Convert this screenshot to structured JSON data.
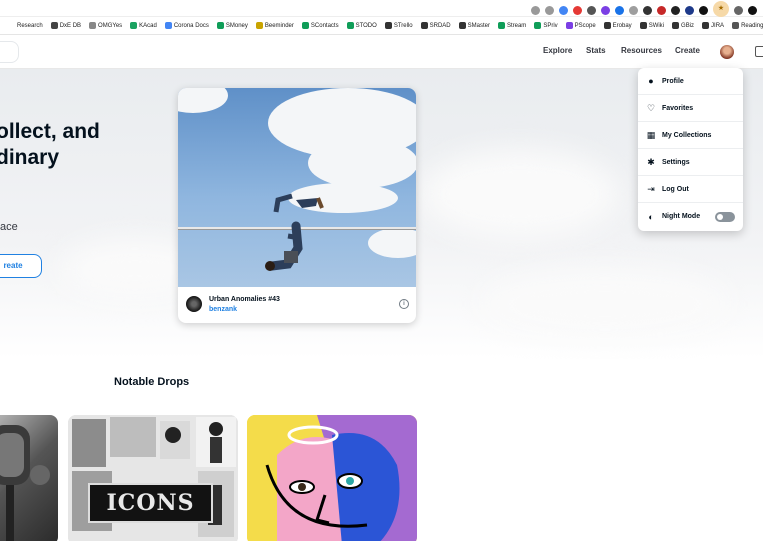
{
  "bookmarks": [
    {
      "label": "Research",
      "color": "#ffffff"
    },
    {
      "label": "DxE DB",
      "color": "#444444"
    },
    {
      "label": "OMGYes",
      "color": "#888888"
    },
    {
      "label": "KAcad",
      "color": "#1aa260"
    },
    {
      "label": "Corona Docs",
      "color": "#4285f4"
    },
    {
      "label": "SMoney",
      "color": "#0f9d58"
    },
    {
      "label": "Beeminder",
      "color": "#c9a400"
    },
    {
      "label": "SContacts",
      "color": "#0f9d58"
    },
    {
      "label": "STODO",
      "color": "#0f9d58"
    },
    {
      "label": "STrello",
      "color": "#333333"
    },
    {
      "label": "SRDAD",
      "color": "#333333"
    },
    {
      "label": "SMaster",
      "color": "#333333"
    },
    {
      "label": "Stream",
      "color": "#0f9d58"
    },
    {
      "label": "SPriv",
      "color": "#0f9d58"
    },
    {
      "label": "PScope",
      "color": "#7b3fe4"
    },
    {
      "label": "Erobay",
      "color": "#333333"
    },
    {
      "label": "SWiki",
      "color": "#333333"
    },
    {
      "label": "GBiz",
      "color": "#333333"
    },
    {
      "label": "JIRA",
      "color": "#333333"
    },
    {
      "label": "Reading L",
      "color": "#555555"
    }
  ],
  "header": {
    "nav": [
      "Explore",
      "Stats",
      "Resources",
      "Create"
    ]
  },
  "hero": {
    "title_line1": "ollect, and",
    "title_line2": "dinary",
    "subtitle": "ace",
    "button_label": "reate"
  },
  "featured": {
    "name": "Urban Anomalies #43",
    "creator": "benzank"
  },
  "dropdown": {
    "items": [
      {
        "label": "Profile",
        "icon": "person-icon"
      },
      {
        "label": "Favorites",
        "icon": "heart-icon"
      },
      {
        "label": "My Collections",
        "icon": "grid-icon"
      },
      {
        "label": "Settings",
        "icon": "gear-icon"
      },
      {
        "label": "Log Out",
        "icon": "logout-icon"
      },
      {
        "label": "Night Mode",
        "icon": "moon-icon"
      }
    ],
    "night_mode_on": false
  },
  "drops": {
    "title": "Notable Drops",
    "items": [
      {
        "image": "microphone-artwork"
      },
      {
        "image": "collage-artwork",
        "text": "ICONS"
      },
      {
        "image": "abstract-face-artwork"
      }
    ]
  },
  "colors": {
    "accent": "#2081e2",
    "text": "#04111d"
  }
}
